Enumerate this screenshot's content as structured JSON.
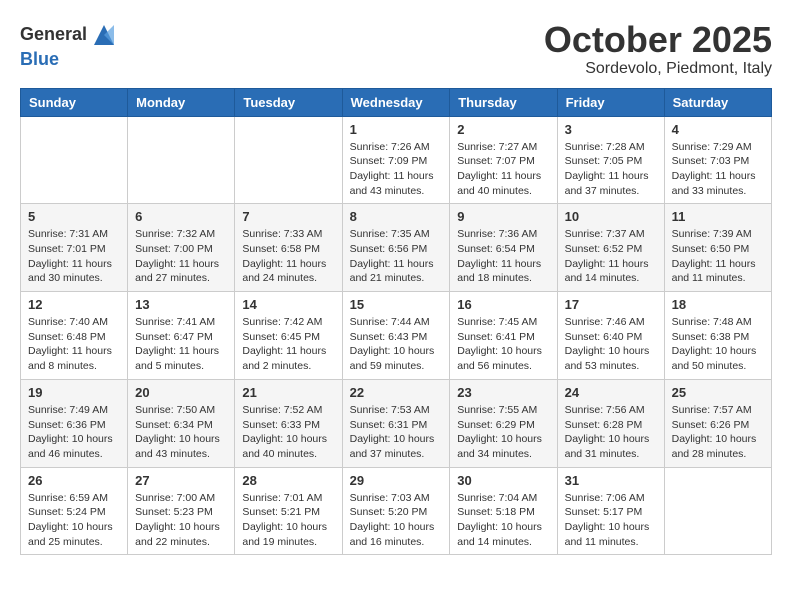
{
  "header": {
    "logo_line1": "General",
    "logo_line2": "Blue",
    "month": "October 2025",
    "location": "Sordevolo, Piedmont, Italy"
  },
  "weekdays": [
    "Sunday",
    "Monday",
    "Tuesday",
    "Wednesday",
    "Thursday",
    "Friday",
    "Saturday"
  ],
  "weeks": [
    [
      {
        "day": "",
        "info": ""
      },
      {
        "day": "",
        "info": ""
      },
      {
        "day": "",
        "info": ""
      },
      {
        "day": "1",
        "info": "Sunrise: 7:26 AM\nSunset: 7:09 PM\nDaylight: 11 hours and 43 minutes."
      },
      {
        "day": "2",
        "info": "Sunrise: 7:27 AM\nSunset: 7:07 PM\nDaylight: 11 hours and 40 minutes."
      },
      {
        "day": "3",
        "info": "Sunrise: 7:28 AM\nSunset: 7:05 PM\nDaylight: 11 hours and 37 minutes."
      },
      {
        "day": "4",
        "info": "Sunrise: 7:29 AM\nSunset: 7:03 PM\nDaylight: 11 hours and 33 minutes."
      }
    ],
    [
      {
        "day": "5",
        "info": "Sunrise: 7:31 AM\nSunset: 7:01 PM\nDaylight: 11 hours and 30 minutes."
      },
      {
        "day": "6",
        "info": "Sunrise: 7:32 AM\nSunset: 7:00 PM\nDaylight: 11 hours and 27 minutes."
      },
      {
        "day": "7",
        "info": "Sunrise: 7:33 AM\nSunset: 6:58 PM\nDaylight: 11 hours and 24 minutes."
      },
      {
        "day": "8",
        "info": "Sunrise: 7:35 AM\nSunset: 6:56 PM\nDaylight: 11 hours and 21 minutes."
      },
      {
        "day": "9",
        "info": "Sunrise: 7:36 AM\nSunset: 6:54 PM\nDaylight: 11 hours and 18 minutes."
      },
      {
        "day": "10",
        "info": "Sunrise: 7:37 AM\nSunset: 6:52 PM\nDaylight: 11 hours and 14 minutes."
      },
      {
        "day": "11",
        "info": "Sunrise: 7:39 AM\nSunset: 6:50 PM\nDaylight: 11 hours and 11 minutes."
      }
    ],
    [
      {
        "day": "12",
        "info": "Sunrise: 7:40 AM\nSunset: 6:48 PM\nDaylight: 11 hours and 8 minutes."
      },
      {
        "day": "13",
        "info": "Sunrise: 7:41 AM\nSunset: 6:47 PM\nDaylight: 11 hours and 5 minutes."
      },
      {
        "day": "14",
        "info": "Sunrise: 7:42 AM\nSunset: 6:45 PM\nDaylight: 11 hours and 2 minutes."
      },
      {
        "day": "15",
        "info": "Sunrise: 7:44 AM\nSunset: 6:43 PM\nDaylight: 10 hours and 59 minutes."
      },
      {
        "day": "16",
        "info": "Sunrise: 7:45 AM\nSunset: 6:41 PM\nDaylight: 10 hours and 56 minutes."
      },
      {
        "day": "17",
        "info": "Sunrise: 7:46 AM\nSunset: 6:40 PM\nDaylight: 10 hours and 53 minutes."
      },
      {
        "day": "18",
        "info": "Sunrise: 7:48 AM\nSunset: 6:38 PM\nDaylight: 10 hours and 50 minutes."
      }
    ],
    [
      {
        "day": "19",
        "info": "Sunrise: 7:49 AM\nSunset: 6:36 PM\nDaylight: 10 hours and 46 minutes."
      },
      {
        "day": "20",
        "info": "Sunrise: 7:50 AM\nSunset: 6:34 PM\nDaylight: 10 hours and 43 minutes."
      },
      {
        "day": "21",
        "info": "Sunrise: 7:52 AM\nSunset: 6:33 PM\nDaylight: 10 hours and 40 minutes."
      },
      {
        "day": "22",
        "info": "Sunrise: 7:53 AM\nSunset: 6:31 PM\nDaylight: 10 hours and 37 minutes."
      },
      {
        "day": "23",
        "info": "Sunrise: 7:55 AM\nSunset: 6:29 PM\nDaylight: 10 hours and 34 minutes."
      },
      {
        "day": "24",
        "info": "Sunrise: 7:56 AM\nSunset: 6:28 PM\nDaylight: 10 hours and 31 minutes."
      },
      {
        "day": "25",
        "info": "Sunrise: 7:57 AM\nSunset: 6:26 PM\nDaylight: 10 hours and 28 minutes."
      }
    ],
    [
      {
        "day": "26",
        "info": "Sunrise: 6:59 AM\nSunset: 5:24 PM\nDaylight: 10 hours and 25 minutes."
      },
      {
        "day": "27",
        "info": "Sunrise: 7:00 AM\nSunset: 5:23 PM\nDaylight: 10 hours and 22 minutes."
      },
      {
        "day": "28",
        "info": "Sunrise: 7:01 AM\nSunset: 5:21 PM\nDaylight: 10 hours and 19 minutes."
      },
      {
        "day": "29",
        "info": "Sunrise: 7:03 AM\nSunset: 5:20 PM\nDaylight: 10 hours and 16 minutes."
      },
      {
        "day": "30",
        "info": "Sunrise: 7:04 AM\nSunset: 5:18 PM\nDaylight: 10 hours and 14 minutes."
      },
      {
        "day": "31",
        "info": "Sunrise: 7:06 AM\nSunset: 5:17 PM\nDaylight: 10 hours and 11 minutes."
      },
      {
        "day": "",
        "info": ""
      }
    ]
  ]
}
